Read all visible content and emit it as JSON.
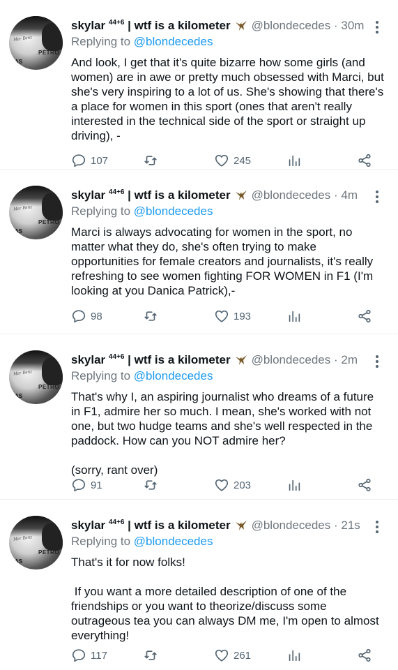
{
  "tweets": [
    {
      "display_name": "skylar",
      "superscript": "44+6",
      "name_suffix": "| wtf is a kilometer",
      "handle_time": "@blondecedes · 30m",
      "replying_prefix": "Replying to",
      "replying_handle": "@blondecedes",
      "text": "And look, I get that it's quite bizarre how some girls (and women) are in awe or pretty much obsessed with Marci, but she's very inspiring to a lot of us. She's showing that there's a place for women in this sport (ones that aren't really interested in the technical side of the sport or straight up driving), -",
      "replies": "107",
      "likes": "245"
    },
    {
      "display_name": "skylar",
      "superscript": "44+6",
      "name_suffix": "| wtf is a kilometer",
      "handle_time": "@blondecedes · 4m",
      "replying_prefix": "Replying to",
      "replying_handle": "@blondecedes",
      "text": "Marci is always advocating for women in the sport, no matter what they do, she's often trying to make opportunities for female creators and journalists, it's really refreshing to see women fighting FOR WOMEN in F1 (I'm looking at you Danica Patrick),-",
      "replies": "98",
      "likes": "193"
    },
    {
      "display_name": "skylar",
      "superscript": "44+6",
      "name_suffix": "| wtf is a kilometer",
      "handle_time": "@blondecedes · 2m",
      "replying_prefix": "Replying to",
      "replying_handle": "@blondecedes",
      "text": "That's why I, an aspiring journalist who dreams of a future in F1, admire her so much. I mean, she's worked with not one, but two hudge teams and she's well respected in the paddock. How can you NOT admire her?\n\n(sorry, rant over)",
      "replies": "91",
      "likes": "203"
    },
    {
      "display_name": "skylar",
      "superscript": "44+6",
      "name_suffix": "| wtf is a kilometer",
      "handle_time": "@blondecedes · 21s",
      "replying_prefix": "Replying to",
      "replying_handle": "@blondecedes",
      "text": "That's it for now folks!\n\n If you want a more detailed description of one of the friendships or you want to theorize/discuss some outrageous tea you can always DM me, I'm open to almost everything!",
      "replies": "117",
      "likes": "261"
    }
  ],
  "avatar_text": {
    "brand": "PETRO",
    "side": "AS",
    "script": "Mer Benz"
  },
  "icons": {
    "reply": "speech-bubble-icon",
    "retweet": "retweet-icon",
    "like": "heart-icon",
    "stats": "bar-chart-icon",
    "share": "share-icon",
    "more": "more-vertical-icon",
    "emoji": "eagle-icon"
  },
  "colors": {
    "link": "#1d9bf0",
    "muted": "#6e767d",
    "text": "#0f1419",
    "icon": "#536471"
  }
}
